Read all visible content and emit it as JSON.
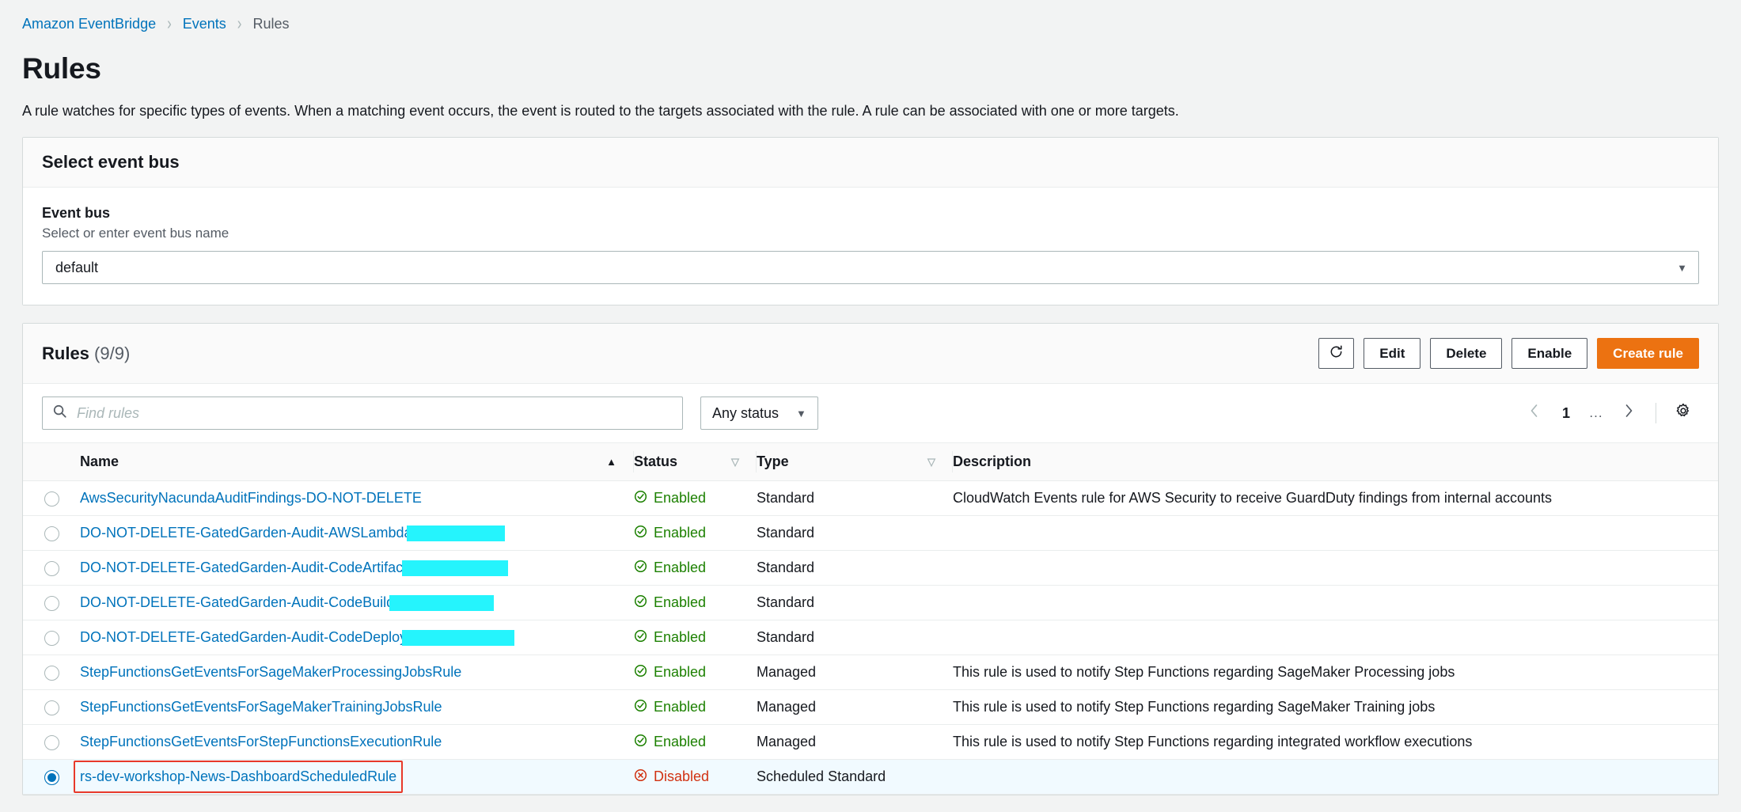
{
  "breadcrumb": {
    "items": [
      {
        "label": "Amazon EventBridge",
        "link": true
      },
      {
        "label": "Events",
        "link": true
      },
      {
        "label": "Rules",
        "link": false
      }
    ],
    "separator": "›"
  },
  "page": {
    "title": "Rules",
    "description": "A rule watches for specific types of events. When a matching event occurs, the event is routed to the targets associated with the rule. A rule can be associated with one or more targets."
  },
  "event_bus_panel": {
    "header": "Select event bus",
    "field_label": "Event bus",
    "field_hint": "Select or enter event bus name",
    "selected_value": "default",
    "caret_icon": "caret-down-icon"
  },
  "rules_panel": {
    "title": "Rules",
    "count": "(9/9)",
    "actions": {
      "refresh_icon": "refresh-icon",
      "edit_label": "Edit",
      "delete_label": "Delete",
      "enable_label": "Enable",
      "create_label": "Create rule"
    },
    "search": {
      "placeholder": "Find rules",
      "value": "",
      "icon": "search-icon"
    },
    "status_filter": {
      "label": "Any status",
      "caret_icon": "caret-down-icon"
    },
    "pagination": {
      "prev_icon": "chevron-left-icon",
      "current_page": "1",
      "ellipsis": "...",
      "next_icon": "chevron-right-icon",
      "settings_icon": "gear-icon"
    },
    "columns": {
      "name": "Name",
      "status": "Status",
      "type": "Type",
      "description": "Description",
      "name_sort": "ascending",
      "status_sort": "none",
      "type_sort": "none"
    },
    "rows": [
      {
        "selected": false,
        "name": "AwsSecurityNacundaAuditFindings-DO-NOT-DELETE",
        "redaction_width": 0,
        "status": "Enabled",
        "status_state": "enabled",
        "type": "Standard",
        "description": "CloudWatch Events rule for AWS Security to receive GuardDuty findings from internal accounts",
        "annotated": false
      },
      {
        "selected": false,
        "name": "DO-NOT-DELETE-GatedGarden-Audit-AWSLambda",
        "redaction_width": 124,
        "status": "Enabled",
        "status_state": "enabled",
        "type": "Standard",
        "description": "",
        "annotated": false
      },
      {
        "selected": false,
        "name": "DO-NOT-DELETE-GatedGarden-Audit-CodeArtifact",
        "redaction_width": 134,
        "status": "Enabled",
        "status_state": "enabled",
        "type": "Standard",
        "description": "",
        "annotated": false
      },
      {
        "selected": false,
        "name": "DO-NOT-DELETE-GatedGarden-Audit-CodeBuild",
        "redaction_width": 132,
        "status": "Enabled",
        "status_state": "enabled",
        "type": "Standard",
        "description": "",
        "annotated": false
      },
      {
        "selected": false,
        "name": "DO-NOT-DELETE-GatedGarden-Audit-CodeDeploy",
        "redaction_width": 142,
        "status": "Enabled",
        "status_state": "enabled",
        "type": "Standard",
        "description": "",
        "annotated": false
      },
      {
        "selected": false,
        "name": "StepFunctionsGetEventsForSageMakerProcessingJobsRule",
        "redaction_width": 0,
        "status": "Enabled",
        "status_state": "enabled",
        "type": "Managed",
        "description": "This rule is used to notify Step Functions regarding SageMaker Processing jobs",
        "annotated": false
      },
      {
        "selected": false,
        "name": "StepFunctionsGetEventsForSageMakerTrainingJobsRule",
        "redaction_width": 0,
        "status": "Enabled",
        "status_state": "enabled",
        "type": "Managed",
        "description": "This rule is used to notify Step Functions regarding SageMaker Training jobs",
        "annotated": false
      },
      {
        "selected": false,
        "name": "StepFunctionsGetEventsForStepFunctionsExecutionRule",
        "redaction_width": 0,
        "status": "Enabled",
        "status_state": "enabled",
        "type": "Managed",
        "description": "This rule is used to notify Step Functions regarding integrated workflow executions",
        "annotated": false
      },
      {
        "selected": true,
        "name": "rs-dev-workshop-News-DashboardScheduledRule",
        "redaction_width": 0,
        "status": "Disabled",
        "status_state": "disabled",
        "type": "Scheduled Standard",
        "description": "",
        "annotated": true
      }
    ]
  },
  "colors": {
    "link": "#0073bb",
    "primary_button": "#ec7211",
    "enabled": "#1d8102",
    "disabled": "#d13212",
    "redaction": "#25f4fd",
    "annotation": "#e8392a",
    "selected_row": "#f1faff",
    "selected_border": "#00a1c9"
  }
}
